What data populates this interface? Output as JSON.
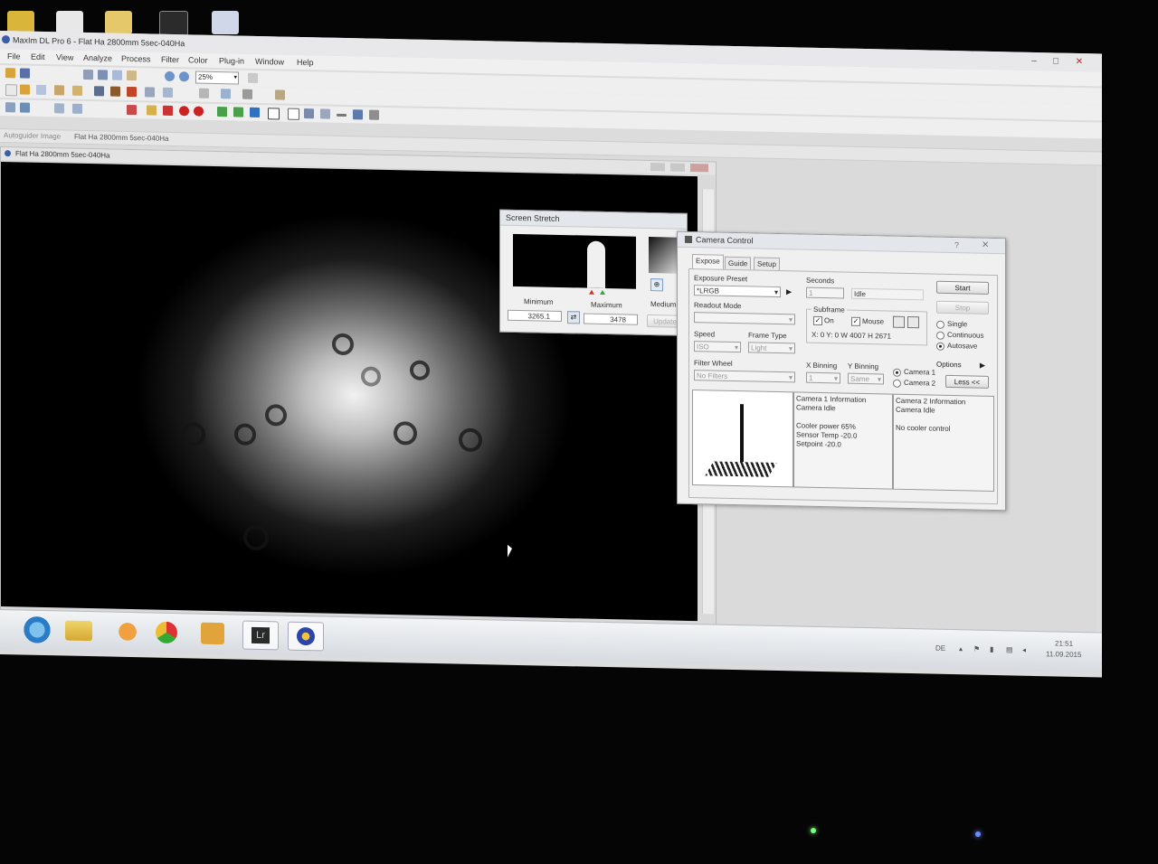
{
  "app": {
    "title": "MaxIm DL Pro 6 - Flat Ha 2800mm 5sec-040Ha",
    "window_controls": [
      "–",
      "□",
      "✕"
    ]
  },
  "menu": [
    "File",
    "Edit",
    "View",
    "Analyze",
    "Process",
    "Filter",
    "Color",
    "Plug-in",
    "Window",
    "Help"
  ],
  "toolbar": {
    "zoom_value": "25%"
  },
  "doc_tabs": [
    "Autoguider Image",
    "Flat Ha 2800mm 5sec-040Ha"
  ],
  "image_window": {
    "title": "Flat Ha 2800mm 5sec-040Ha"
  },
  "screen_stretch": {
    "title": "Screen Stretch",
    "min_label": "Minimum",
    "max_label": "Maximum",
    "min_value": "3265.1",
    "max_value": "3478",
    "mode_label": "Medium",
    "update_label": "Update"
  },
  "camera_control": {
    "title": "Camera Control",
    "tabs": [
      "Expose",
      "Guide",
      "Setup"
    ],
    "exposure_preset_label": "Exposure Preset",
    "exposure_preset_value": "*LRGB",
    "seconds_label": "Seconds",
    "seconds_value": "1",
    "status_value": "Idle",
    "start_label": "Start",
    "stop_label": "Stop",
    "readout_mode_label": "Readout Mode",
    "subframe_label": "Subframe",
    "subframe_on_label": "On",
    "subframe_mouse_label": "Mouse",
    "subframe_coords": "X: 0 Y: 0 W 4007 H 2671",
    "single_label": "Single",
    "continuous_label": "Continuous",
    "autosave_label": "Autosave",
    "speed_label": "Speed",
    "speed_value": "ISO",
    "frame_type_label": "Frame Type",
    "frame_type_value": "Light",
    "options_label": "Options",
    "filter_wheel_label": "Filter Wheel",
    "filter_value": "No Filters",
    "x_binning_label": "X Binning",
    "x_binning_value": "1",
    "y_binning_label": "Y Binning",
    "y_binning_value": "Same",
    "camera1_label": "Camera 1",
    "camera2_label": "Camera 2",
    "less_label": "Less <<",
    "cam1_info": [
      "Camera 1 Information",
      "Camera Idle",
      "",
      "Cooler power 65%",
      "Sensor Temp -20.0",
      "Setpoint -20.0"
    ],
    "cam2_info": [
      "Camera 2 Information",
      "Camera Idle",
      "",
      "No cooler control"
    ]
  },
  "taskbar": {
    "apps": [
      "ie-icon",
      "explorer-icon",
      "media-player-icon",
      "chrome-icon",
      "outlook-icon",
      "lightroom-icon",
      "maxim-icon"
    ],
    "lightroom_text": "Lr",
    "tray_lang": "DE",
    "clock_time": "21:51",
    "clock_date": "11.09.2015"
  }
}
